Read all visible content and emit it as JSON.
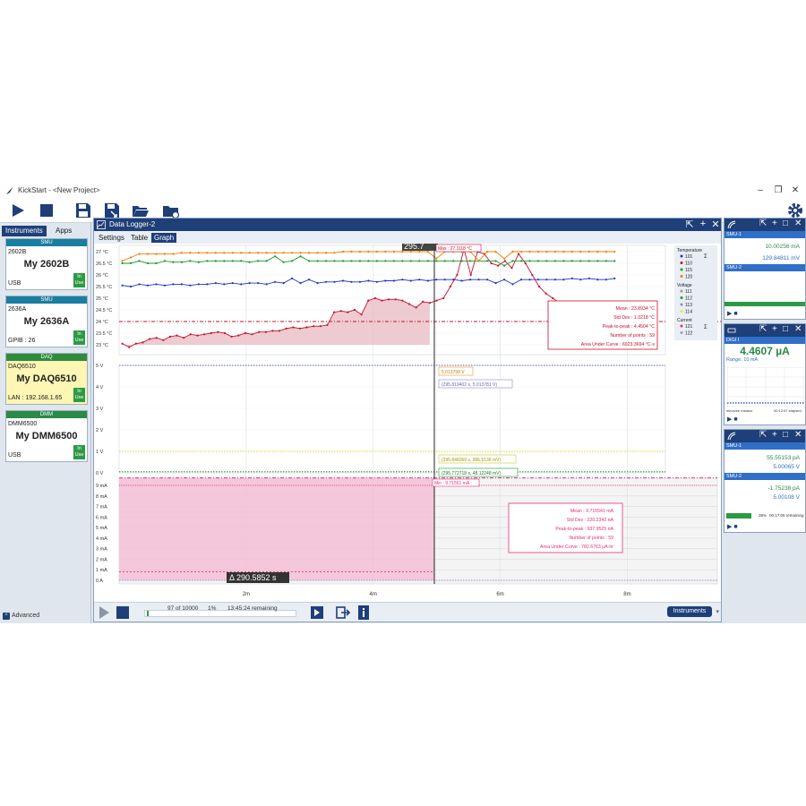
{
  "app": {
    "title": "KickStart - <New Project>"
  },
  "left_panel": {
    "tabs": [
      "Instruments",
      "Apps"
    ],
    "cards": [
      {
        "header": "SMU",
        "model": "2602B",
        "nickname": "My 2602B",
        "connection": "USB",
        "status": "In Use",
        "type": "smu"
      },
      {
        "header": "SMU",
        "model": "2636A",
        "nickname": "My 2636A",
        "connection": "GPIB : 26",
        "status": "In Use",
        "type": "smu"
      },
      {
        "header": "DAQ",
        "model": "DAQ6510",
        "nickname": "My DAQ6510",
        "connection": "LAN : 192.168.1.65",
        "status": "In Use",
        "type": "daq"
      },
      {
        "header": "DMM",
        "model": "DMM6500",
        "nickname": "My DMM6500",
        "connection": "USB",
        "status": "In Use",
        "type": "dmm"
      }
    ],
    "advanced_label": "Advanced"
  },
  "logger": {
    "title": "Data Logger-2",
    "subtabs": [
      "Settings",
      "Table",
      "Graph"
    ],
    "cursor_time": "295.7",
    "delta_label": "Δ 290.5852 s",
    "progress": {
      "count": "97 of 10000",
      "percent": "1%",
      "remaining": "13:45:24 remaining"
    },
    "instruments_button": "Instruments"
  },
  "chart_data": {
    "type": "line",
    "x_ticks": [
      "2m",
      "4m",
      "6m",
      "8m"
    ],
    "temperature_axis": [
      "27 °C",
      "26.5 °C",
      "26 °C",
      "25.5 °C",
      "25 °C",
      "24.5 °C",
      "24 °C",
      "23.5 °C",
      "23 °C"
    ],
    "voltage_axis": [
      "5 V",
      "4 V",
      "3 V",
      "2 V",
      "1 V",
      "0 V"
    ],
    "current_axis": [
      "9 mA",
      "8 mA",
      "7 mA",
      "6 mA",
      "5 mA",
      "4 mA",
      "3 mA",
      "2 mA",
      "1 mA",
      "0 A"
    ],
    "legend": {
      "temperature_title": "Temperature",
      "temperature": [
        {
          "name": "101",
          "color": "#2233cc"
        },
        {
          "name": "110",
          "color": "#c8102e"
        },
        {
          "name": "115",
          "color": "#1a9a2a"
        },
        {
          "name": "120",
          "color": "#ef7d00"
        }
      ],
      "voltage_title": "Voltage",
      "voltage": [
        {
          "name": "111",
          "color": "#999999"
        },
        {
          "name": "112",
          "color": "#1a9a2a"
        },
        {
          "name": "113",
          "color": "#8888cc"
        },
        {
          "name": "114",
          "color": "#e8e050"
        }
      ],
      "current_title": "Current",
      "current": [
        {
          "name": "121",
          "color": "#e0307a"
        },
        {
          "name": "122",
          "color": "#9999cc"
        }
      ]
    },
    "series": [
      {
        "name": "110",
        "values": [
          23.05,
          22.9,
          23.05,
          23.1,
          23.25,
          23.3,
          23.2,
          23.35,
          23.4,
          23.3,
          23.45,
          23.4,
          23.45,
          23.5,
          23.55,
          23.5,
          23.35,
          23.4,
          23.5,
          23.45,
          23.55,
          23.55,
          23.6,
          23.6,
          23.7,
          23.75,
          23.7,
          23.75,
          23.8,
          23.8,
          23.85,
          24.4,
          24.45,
          24.4,
          24.5,
          24.3,
          24.9,
          25.0,
          24.9,
          24.95,
          24.95,
          24.9,
          24.75,
          24.6,
          24.85,
          24.8,
          24.9,
          25.0,
          25.5,
          26.0,
          27.1,
          26.0,
          27.0,
          26.9,
          26.5,
          26.4,
          26.6,
          26.3,
          26.9,
          26.5,
          26.0,
          25.5,
          25.2,
          25.0,
          24.8,
          24.6,
          24.4
        ]
      },
      {
        "name": "101",
        "values": [
          25.55,
          25.5,
          25.6,
          25.55,
          25.6,
          25.55,
          25.6,
          25.6,
          25.55,
          25.6,
          25.6,
          25.65,
          25.6,
          25.65,
          25.6,
          25.65,
          25.65,
          25.6,
          25.7,
          25.65,
          25.85,
          25.65,
          25.8,
          25.65,
          25.7,
          25.7,
          25.75,
          25.7,
          25.7,
          25.75,
          25.7,
          25.75,
          25.75,
          25.8,
          25.75,
          25.8,
          25.75,
          25.8,
          25.8,
          25.8,
          25.75,
          25.8,
          25.8,
          25.8,
          25.65,
          25.8,
          25.6,
          25.8,
          25.8,
          25.8,
          25.8,
          25.8,
          25.8,
          25.85,
          25.8,
          25.85,
          25.8,
          25.8,
          25.85
        ]
      },
      {
        "name": "115",
        "values": [
          26.5,
          26.5,
          26.6,
          26.5,
          26.5,
          26.6,
          26.55,
          26.55,
          26.6,
          26.55,
          26.6,
          26.6,
          26.6,
          26.6,
          26.6,
          26.55,
          26.6,
          26.6,
          26.8,
          26.55,
          26.6,
          26.8,
          26.6,
          26.6,
          26.6,
          26.6,
          26.6,
          26.6,
          26.6,
          26.6,
          26.6,
          26.6,
          26.6,
          26.6,
          26.6,
          26.6,
          26.6,
          26.6,
          26.6,
          26.6,
          26.6,
          26.6,
          26.6,
          26.6,
          26.6,
          26.4,
          26.6,
          26.6,
          26.6,
          26.6,
          26.6,
          26.6,
          26.6,
          26.6,
          26.6,
          26.6,
          26.6,
          26.6,
          26.6
        ]
      },
      {
        "name": "120",
        "values": [
          26.6,
          26.75,
          26.9,
          26.9,
          26.9,
          26.9,
          26.9,
          26.95,
          26.95,
          26.95,
          26.95,
          26.95,
          26.95,
          26.95,
          26.95,
          26.95,
          26.95,
          26.95,
          26.95,
          26.95,
          26.95,
          26.95,
          26.95,
          26.95,
          26.95,
          26.95,
          27.0,
          27.0,
          27.0,
          27.0,
          27.0,
          27.0,
          27.0,
          27.0,
          27.0,
          27.0,
          27.0,
          26.7,
          27.0,
          27.0,
          27.0,
          27.0,
          26.6,
          27.0,
          27.0,
          26.7,
          27.0,
          27.0,
          27.0,
          27.0,
          27.0,
          27.0,
          27.0,
          27.0,
          27.0,
          27.0,
          27.0,
          27.0,
          27.0
        ]
      }
    ],
    "temp_stats": {
      "mean": "Mean : 23.8934 °C",
      "std": "Std Dev : 1.0218 °C",
      "p2p": "Peak-to-peak : 4.4504 °C",
      "n": "Number of points : 59",
      "auc": "Area Under Curve : 6923.3694 °C·s",
      "max": "Max : 27.1118 °C"
    },
    "volt_labels": {
      "v5": "5.013798 V",
      "v5pt": "(295.819402 s, 5.013781 V)",
      "v1pt": "(295.848369 s, 996.5138 mV)",
      "v0pt": "(295.772718 s, 48.12248 mV)"
    },
    "curr_stats": {
      "min": "Min : 9.71551 mA",
      "mean": "Mean : 9.715541 mA",
      "std": "Std Dev : 220.2343 nA",
      "p2p": "Peak-to-peak : 937.9525 nA",
      "n": "Number of points : 59",
      "auc": "Area Under Curve : 782.6763 µA-hr"
    }
  },
  "right_panels": [
    {
      "title": "SMU-1",
      "values": [
        "10.00256 mA",
        "129.84811 mV"
      ],
      "title2": "SMU-2"
    },
    {
      "title": "DIGI I",
      "reading": "4.4607 µA",
      "range": "Range: 10 mA",
      "time_label": "00:12:57 elapsed",
      "tag": "minovee measur"
    },
    {
      "title": "SMU-1",
      "values": [
        "55.55153 pA",
        "5.00065 V"
      ],
      "title2": "SMU-2",
      "values2": [
        "-1.75238 pA",
        "5.00108 V"
      ],
      "progress": "38%",
      "progress_time": "00:17:06 remaining"
    }
  ]
}
